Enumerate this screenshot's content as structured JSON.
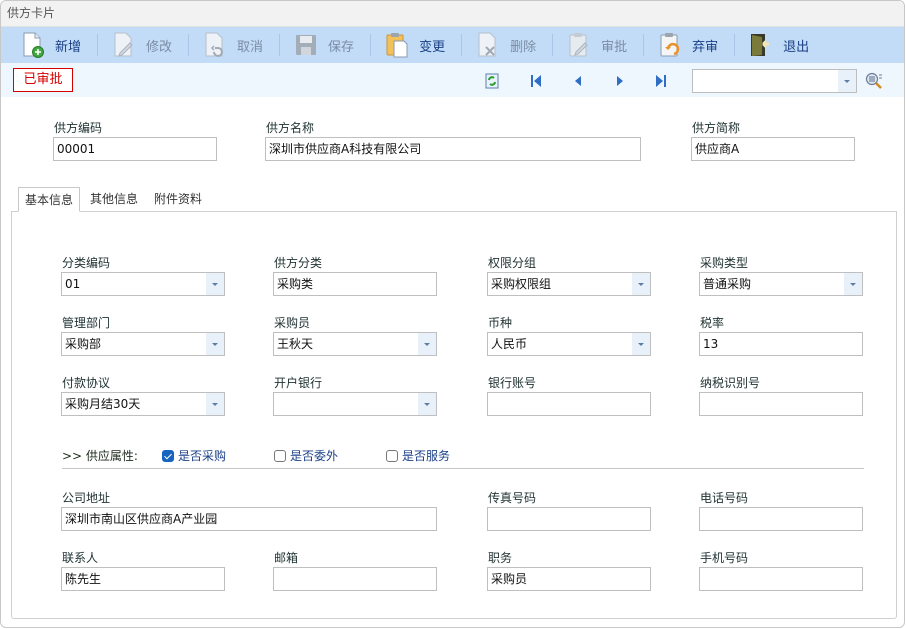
{
  "window": {
    "title": "供方卡片"
  },
  "toolbar": {
    "buttons": [
      {
        "id": "new",
        "label": "新增",
        "icon": "new-document-icon",
        "enabled": true
      },
      {
        "id": "edit",
        "label": "修改",
        "icon": "edit-document-icon",
        "enabled": false
      },
      {
        "id": "cancel",
        "label": "取消",
        "icon": "undo-document-icon",
        "enabled": false
      },
      {
        "id": "save",
        "label": "保存",
        "icon": "save-disk-icon",
        "enabled": false
      },
      {
        "id": "change",
        "label": "变更",
        "icon": "clipboard-icon",
        "enabled": true
      },
      {
        "id": "delete",
        "label": "删除",
        "icon": "delete-document-icon",
        "enabled": false
      },
      {
        "id": "approve",
        "label": "审批",
        "icon": "approve-clipboard-icon",
        "enabled": false
      },
      {
        "id": "unapprove",
        "label": "弃审",
        "icon": "unapprove-clipboard-icon",
        "enabled": true
      },
      {
        "id": "exit",
        "label": "退出",
        "icon": "exit-door-icon",
        "enabled": true
      }
    ]
  },
  "subbar": {
    "status": "已审批",
    "status_color": "#d40000",
    "search_combo_value": ""
  },
  "header_fields": {
    "code": {
      "label": "供方编码",
      "value": "00001"
    },
    "name": {
      "label": "供方名称",
      "value": "深圳市供应商A科技有限公司"
    },
    "short_name": {
      "label": "供方简称",
      "value": "供应商A"
    }
  },
  "tabs": [
    {
      "label": "基本信息",
      "active": true
    },
    {
      "label": "其他信息",
      "active": false
    },
    {
      "label": "附件资料",
      "active": false
    }
  ],
  "basic": {
    "category_code": {
      "label": "分类编码",
      "value": "01"
    },
    "supplier_category": {
      "label": "供方分类",
      "value": "采购类"
    },
    "permission_group": {
      "label": "权限分组",
      "value": "采购权限组"
    },
    "purchase_type": {
      "label": "采购类型",
      "value": "普通采购"
    },
    "department": {
      "label": "管理部门",
      "value": "采购部"
    },
    "buyer": {
      "label": "采购员",
      "value": "王秋天"
    },
    "currency": {
      "label": "币种",
      "value": "人民币"
    },
    "tax_rate": {
      "label": "税率",
      "value": "13"
    },
    "payment_terms": {
      "label": "付款协议",
      "value": "采购月结30天"
    },
    "bank": {
      "label": "开户银行",
      "value": ""
    },
    "bank_account": {
      "label": "银行账号",
      "value": ""
    },
    "tax_id": {
      "label": "纳税识别号",
      "value": ""
    }
  },
  "attributes": {
    "label": ">> 供应属性:",
    "options": [
      {
        "label": "是否采购",
        "checked": true
      },
      {
        "label": "是否委外",
        "checked": false
      },
      {
        "label": "是否服务",
        "checked": false
      }
    ]
  },
  "contact": {
    "address": {
      "label": "公司地址",
      "value": "深圳市南山区供应商A产业园"
    },
    "fax": {
      "label": "传真号码",
      "value": ""
    },
    "phone": {
      "label": "电话号码",
      "value": ""
    },
    "contact_person": {
      "label": "联系人",
      "value": "陈先生"
    },
    "email": {
      "label": "邮箱",
      "value": ""
    },
    "position": {
      "label": "职务",
      "value": "采购员"
    },
    "mobile": {
      "label": "手机号码",
      "value": ""
    }
  }
}
